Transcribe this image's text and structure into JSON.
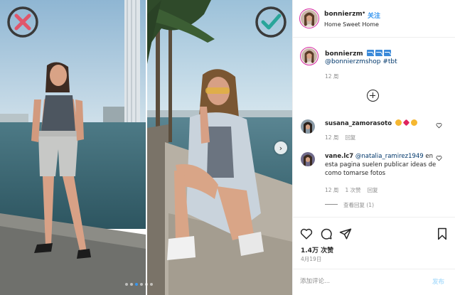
{
  "photo": {
    "bad_mark": "cross-mark-icon",
    "good_mark": "check-mark-icon",
    "next_arrow_glyph": "›",
    "carousel_dot_count": 6,
    "carousel_active_index": 2
  },
  "header": {
    "username": "bonnierzm",
    "separator": "•",
    "follow_label": "关注",
    "location": "Home Sweet Home"
  },
  "caption": {
    "username": "bonnierzm",
    "text": "@bonnierzmshop #tbt",
    "time": "12 周"
  },
  "comments": [
    {
      "username": "susana_zamorasoto",
      "time": "12 周",
      "reply_label": "回复"
    },
    {
      "username": "vane.lc7",
      "mention": "@natalia_ramirez1949",
      "text": " en esta pagina suelen publicar ideas de como tomarse fotos",
      "time": "12 周",
      "likes": "1 次赞",
      "reply_label": "回复",
      "view_replies": "查看回复 (1)"
    }
  ],
  "actions": {
    "likes": "1.4万 次赞",
    "date": "4月19日"
  },
  "comment_box": {
    "placeholder": "添加评论...",
    "post_label": "发布"
  },
  "colors": {
    "accent_blue": "#3897f0",
    "bad_mark_color": "#e0566b",
    "good_mark_color": "#2aa59a",
    "muted_text": "#8e8e8e"
  }
}
